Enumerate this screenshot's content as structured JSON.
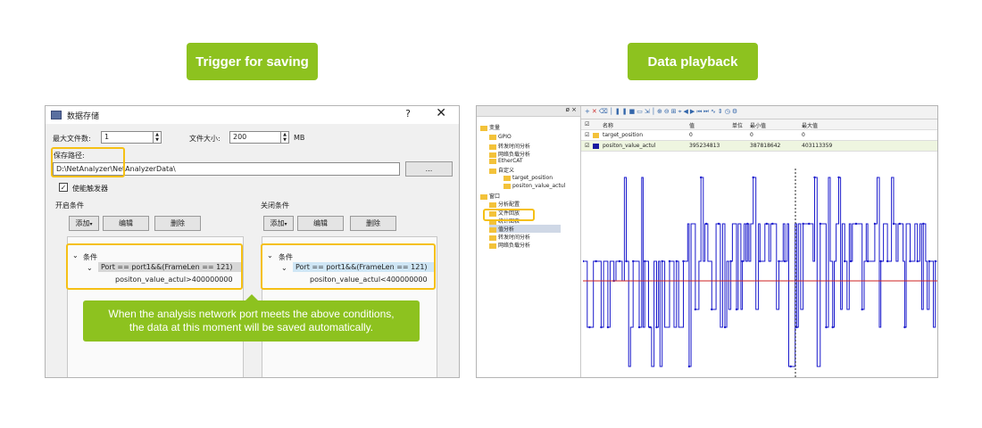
{
  "left_title": "Trigger for saving",
  "right_title": "Data playback",
  "dialog": {
    "title": "数据存储",
    "help": "?",
    "close": "✕",
    "max_files_label": "最大文件数:",
    "max_files_value": "1",
    "file_size_label": "文件大小:",
    "file_size_value": "200",
    "file_size_unit": "MB",
    "save_path_label": "保存路径:",
    "save_path_value": "D:\\NetAnalyzer\\NetAnalyzerData\\",
    "browse_label": "...",
    "enable_trigger_label": "使能触发器",
    "start_group": {
      "title": "开启条件",
      "add": "添加",
      "edit": "编辑",
      "delete": "删除",
      "root": "条件",
      "rule": "Port == port1&&(FrameLen == 121)",
      "sub": "positon_value_actul>400000000"
    },
    "stop_group": {
      "title": "关闭条件",
      "add": "添加",
      "edit": "编辑",
      "delete": "删除",
      "root": "条件",
      "rule": "Port == port1&&(FrameLen == 121)",
      "sub": "positon_value_actul<400000000"
    }
  },
  "callout": {
    "line1": "When the analysis network port meets the above conditions,",
    "line2": "the data at this moment will be saved automatically."
  },
  "playback": {
    "pin": "ø ×",
    "tree": [
      "变量",
      "GPIO",
      "转发时间分析",
      "网络负载分析",
      "EtherCAT",
      "自定义",
      "target_position",
      "positon_value_actul",
      "窗口",
      "分析配置",
      "文件回放",
      "统计图表",
      "值分析",
      "转发时间分析",
      "网络负载分析"
    ],
    "columns": [
      "名称",
      "值",
      "单位",
      "最小值",
      "最大值"
    ],
    "rows": [
      {
        "name": "target_position",
        "value": "0",
        "unit": "",
        "min": "0",
        "max": "0",
        "color": "#f3c23a"
      },
      {
        "name": "positon_value_actul",
        "value": "395234813",
        "unit": "",
        "min": "387818642",
        "max": "403113359",
        "color": "#1a1aa0"
      }
    ]
  },
  "colors": {
    "accent": "#8dc21f",
    "highlight": "#f5c015",
    "signal": "#1a1acc",
    "threshold": "#cc2222"
  }
}
